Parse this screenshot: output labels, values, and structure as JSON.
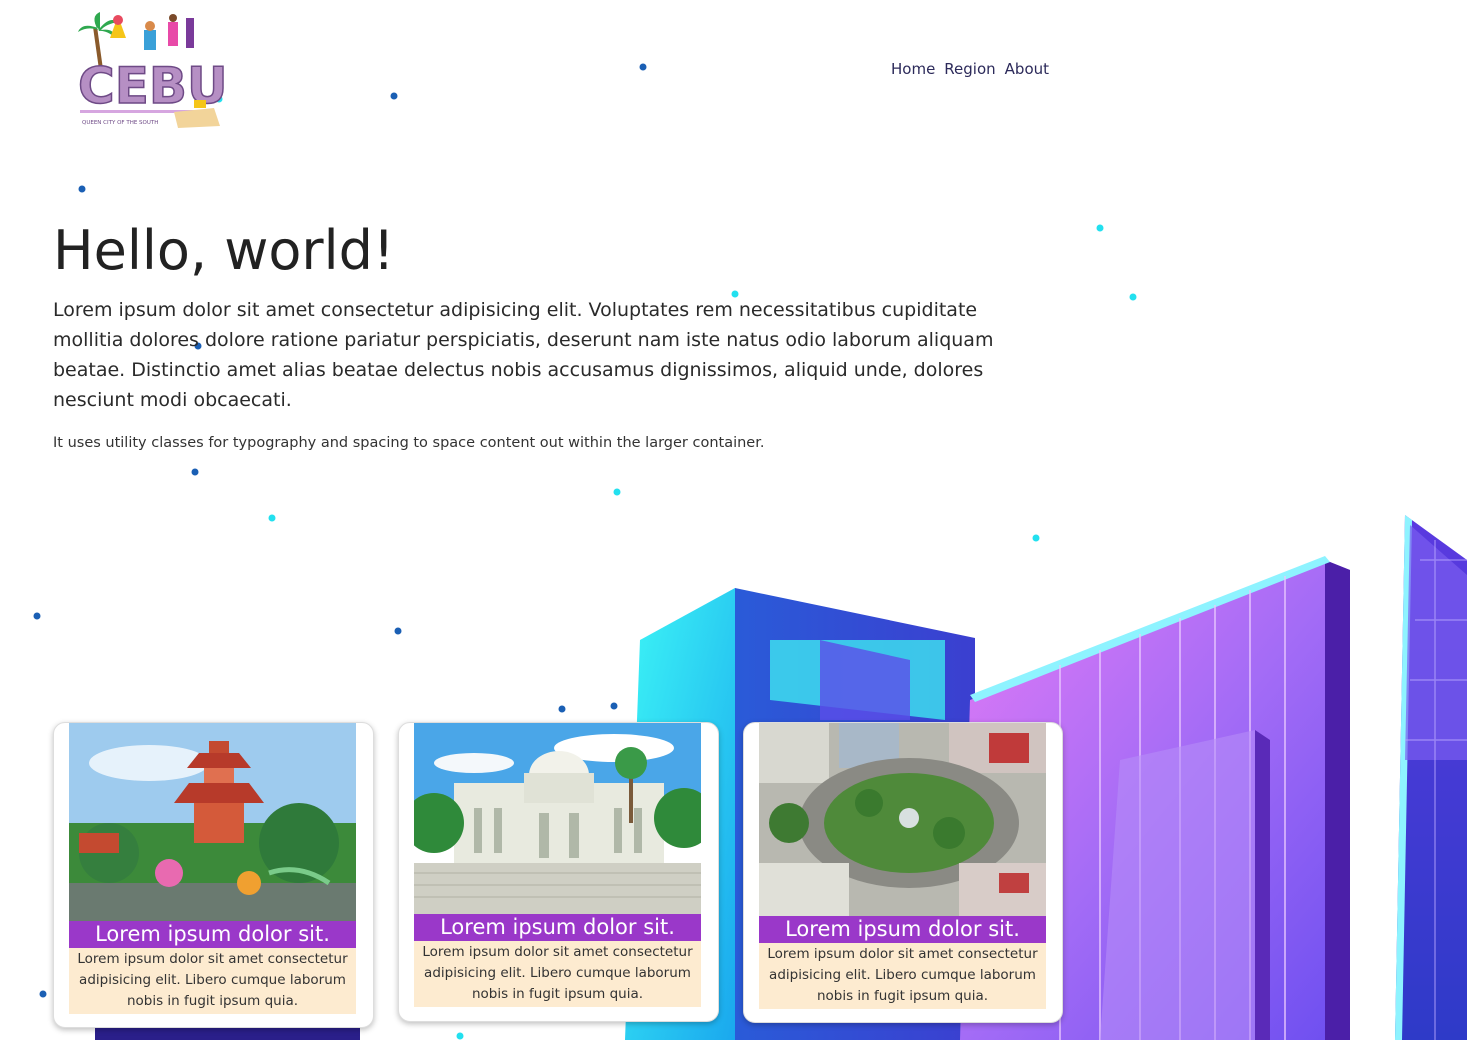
{
  "header": {
    "logo_text": "CEBU",
    "logo_tagline": "QUEEN CITY OF THE SOUTH",
    "nav": [
      {
        "label": "Home"
      },
      {
        "label": "Region"
      },
      {
        "label": "About"
      }
    ]
  },
  "hero": {
    "title": "Hello, world!",
    "lead": "Lorem ipsum dolor sit amet consectetur adipisicing elit. Voluptates rem necessitatibus cupiditate mollitia dolores dolore ratione pariatur perspiciatis, deserunt nam iste natus odio laborum aliquam beatae. Distinctio amet alias beatae delectus nobis accusamus dignissimos, aliquid unde, dolores nesciunt modi obcaecati.",
    "note": "It uses utility classes for typography and spacing to space content out within the larger container."
  },
  "cards": [
    {
      "title": "Lorem ipsum dolor sit.",
      "text": "Lorem ipsum dolor sit amet consectetur adipisicing elit. Libero cumque laborum nobis in fugit ipsum quia.",
      "image": "taoist-temple-image"
    },
    {
      "title": "Lorem ipsum dolor sit.",
      "text": "Lorem ipsum dolor sit amet consectetur adipisicing elit. Libero cumque laborum nobis in fugit ipsum quia.",
      "image": "capitol-building-image"
    },
    {
      "title": "Lorem ipsum dolor sit.",
      "text": "Lorem ipsum dolor sit amet consectetur adipisicing elit. Libero cumque laborum nobis in fugit ipsum quia.",
      "image": "rotunda-aerial-image"
    }
  ],
  "colors": {
    "nav_text": "#2c2a5a",
    "card_title_bg": "#9a38c9",
    "card_body_bg": "#fdebd0",
    "dot_dark": "#1a5fb4",
    "dot_light": "#22e0ef"
  }
}
